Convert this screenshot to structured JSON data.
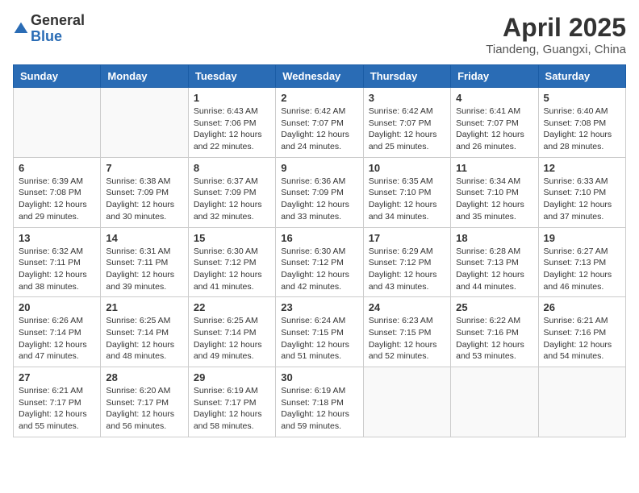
{
  "logo": {
    "general": "General",
    "blue": "Blue"
  },
  "title": "April 2025",
  "location": "Tiandeng, Guangxi, China",
  "weekdays": [
    "Sunday",
    "Monday",
    "Tuesday",
    "Wednesday",
    "Thursday",
    "Friday",
    "Saturday"
  ],
  "weeks": [
    [
      {
        "day": "",
        "info": ""
      },
      {
        "day": "",
        "info": ""
      },
      {
        "day": "1",
        "info": "Sunrise: 6:43 AM\nSunset: 7:06 PM\nDaylight: 12 hours and 22 minutes."
      },
      {
        "day": "2",
        "info": "Sunrise: 6:42 AM\nSunset: 7:07 PM\nDaylight: 12 hours and 24 minutes."
      },
      {
        "day": "3",
        "info": "Sunrise: 6:42 AM\nSunset: 7:07 PM\nDaylight: 12 hours and 25 minutes."
      },
      {
        "day": "4",
        "info": "Sunrise: 6:41 AM\nSunset: 7:07 PM\nDaylight: 12 hours and 26 minutes."
      },
      {
        "day": "5",
        "info": "Sunrise: 6:40 AM\nSunset: 7:08 PM\nDaylight: 12 hours and 28 minutes."
      }
    ],
    [
      {
        "day": "6",
        "info": "Sunrise: 6:39 AM\nSunset: 7:08 PM\nDaylight: 12 hours and 29 minutes."
      },
      {
        "day": "7",
        "info": "Sunrise: 6:38 AM\nSunset: 7:09 PM\nDaylight: 12 hours and 30 minutes."
      },
      {
        "day": "8",
        "info": "Sunrise: 6:37 AM\nSunset: 7:09 PM\nDaylight: 12 hours and 32 minutes."
      },
      {
        "day": "9",
        "info": "Sunrise: 6:36 AM\nSunset: 7:09 PM\nDaylight: 12 hours and 33 minutes."
      },
      {
        "day": "10",
        "info": "Sunrise: 6:35 AM\nSunset: 7:10 PM\nDaylight: 12 hours and 34 minutes."
      },
      {
        "day": "11",
        "info": "Sunrise: 6:34 AM\nSunset: 7:10 PM\nDaylight: 12 hours and 35 minutes."
      },
      {
        "day": "12",
        "info": "Sunrise: 6:33 AM\nSunset: 7:10 PM\nDaylight: 12 hours and 37 minutes."
      }
    ],
    [
      {
        "day": "13",
        "info": "Sunrise: 6:32 AM\nSunset: 7:11 PM\nDaylight: 12 hours and 38 minutes."
      },
      {
        "day": "14",
        "info": "Sunrise: 6:31 AM\nSunset: 7:11 PM\nDaylight: 12 hours and 39 minutes."
      },
      {
        "day": "15",
        "info": "Sunrise: 6:30 AM\nSunset: 7:12 PM\nDaylight: 12 hours and 41 minutes."
      },
      {
        "day": "16",
        "info": "Sunrise: 6:30 AM\nSunset: 7:12 PM\nDaylight: 12 hours and 42 minutes."
      },
      {
        "day": "17",
        "info": "Sunrise: 6:29 AM\nSunset: 7:12 PM\nDaylight: 12 hours and 43 minutes."
      },
      {
        "day": "18",
        "info": "Sunrise: 6:28 AM\nSunset: 7:13 PM\nDaylight: 12 hours and 44 minutes."
      },
      {
        "day": "19",
        "info": "Sunrise: 6:27 AM\nSunset: 7:13 PM\nDaylight: 12 hours and 46 minutes."
      }
    ],
    [
      {
        "day": "20",
        "info": "Sunrise: 6:26 AM\nSunset: 7:14 PM\nDaylight: 12 hours and 47 minutes."
      },
      {
        "day": "21",
        "info": "Sunrise: 6:25 AM\nSunset: 7:14 PM\nDaylight: 12 hours and 48 minutes."
      },
      {
        "day": "22",
        "info": "Sunrise: 6:25 AM\nSunset: 7:14 PM\nDaylight: 12 hours and 49 minutes."
      },
      {
        "day": "23",
        "info": "Sunrise: 6:24 AM\nSunset: 7:15 PM\nDaylight: 12 hours and 51 minutes."
      },
      {
        "day": "24",
        "info": "Sunrise: 6:23 AM\nSunset: 7:15 PM\nDaylight: 12 hours and 52 minutes."
      },
      {
        "day": "25",
        "info": "Sunrise: 6:22 AM\nSunset: 7:16 PM\nDaylight: 12 hours and 53 minutes."
      },
      {
        "day": "26",
        "info": "Sunrise: 6:21 AM\nSunset: 7:16 PM\nDaylight: 12 hours and 54 minutes."
      }
    ],
    [
      {
        "day": "27",
        "info": "Sunrise: 6:21 AM\nSunset: 7:17 PM\nDaylight: 12 hours and 55 minutes."
      },
      {
        "day": "28",
        "info": "Sunrise: 6:20 AM\nSunset: 7:17 PM\nDaylight: 12 hours and 56 minutes."
      },
      {
        "day": "29",
        "info": "Sunrise: 6:19 AM\nSunset: 7:17 PM\nDaylight: 12 hours and 58 minutes."
      },
      {
        "day": "30",
        "info": "Sunrise: 6:19 AM\nSunset: 7:18 PM\nDaylight: 12 hours and 59 minutes."
      },
      {
        "day": "",
        "info": ""
      },
      {
        "day": "",
        "info": ""
      },
      {
        "day": "",
        "info": ""
      }
    ]
  ]
}
